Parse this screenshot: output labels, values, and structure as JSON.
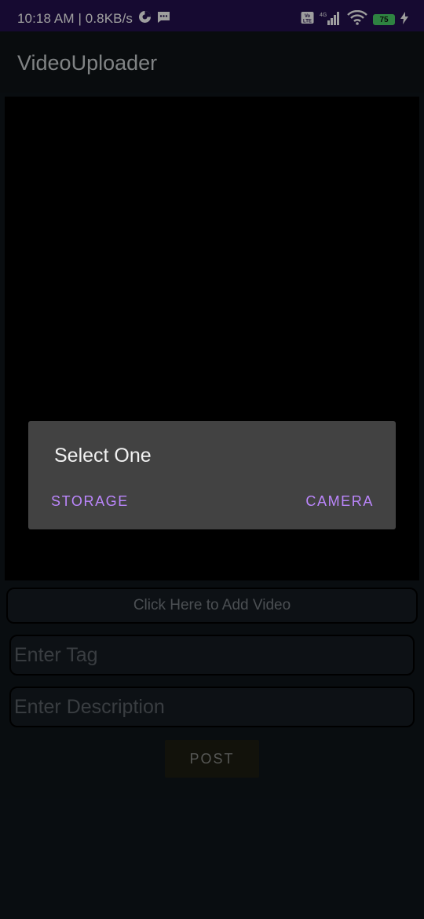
{
  "status_bar": {
    "time": "10:18 AM | 0.8KB/s",
    "battery": "75",
    "network_label": "4G",
    "volte_label": "Vo LTE"
  },
  "app": {
    "title": "VideoUploader"
  },
  "main": {
    "add_video_label": "Click Here to Add Video",
    "tag_placeholder": "Enter Tag",
    "description_placeholder": "Enter Description",
    "post_label": "POST"
  },
  "dialog": {
    "title": "Select One",
    "storage_label": "STORAGE",
    "camera_label": "CAMERA"
  },
  "colors": {
    "status_bar": "#25114f",
    "accent": "#bb86fc",
    "dialog_bg": "#424242"
  },
  "icons": [
    "data-saver-icon",
    "chat-icon",
    "volte-icon",
    "signal-icon",
    "wifi-icon",
    "battery-icon",
    "charging-icon"
  ]
}
